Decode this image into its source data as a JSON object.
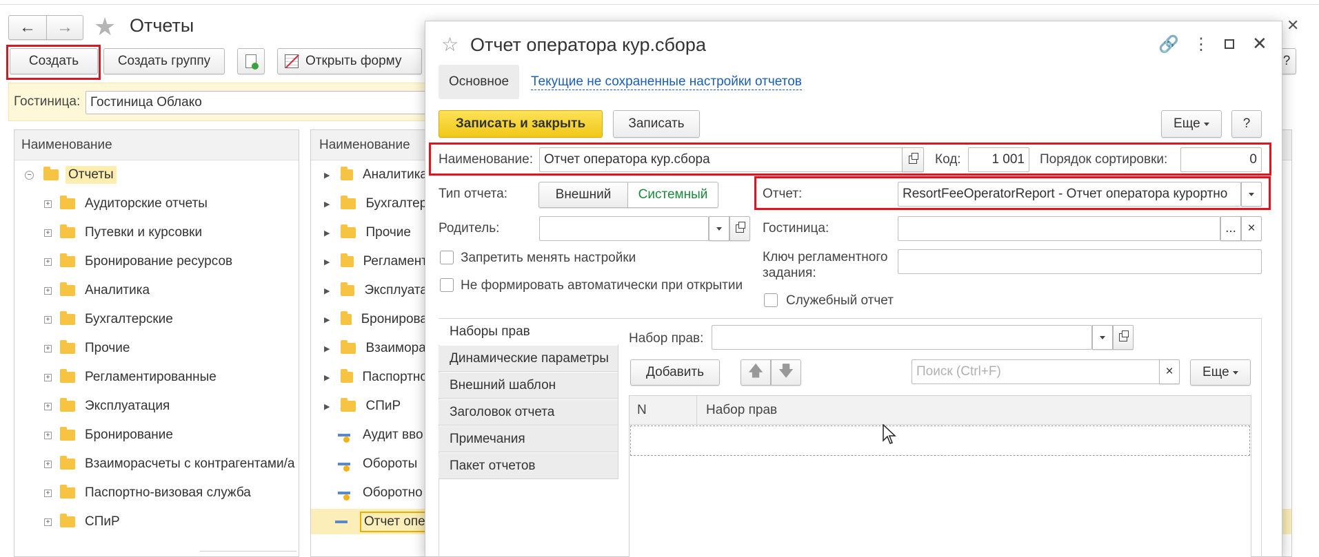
{
  "main": {
    "nav_back": "←",
    "nav_forward": "→",
    "title": "Отчеты",
    "toolbar": {
      "create": "Создать",
      "create_group": "Создать группу",
      "open_form": "Открыть форму"
    },
    "filter": {
      "label": "Гостиница:",
      "value": "Гостиница Облако"
    },
    "left_tree": {
      "header": "Наименование",
      "root": "Отчеты",
      "items": [
        "Аудиторские отчеты",
        "Путевки и курсовки",
        "Бронирование ресурсов",
        "Аналитика",
        "Бухгалтерские",
        "Прочие",
        "Регламентированные",
        "Эксплуатация",
        "Бронирование",
        "Взаиморасчеты с контрагентами/а",
        "Паспортно-визовая служба",
        "СПиР"
      ]
    },
    "right_list": {
      "header": "Наименование",
      "folders": [
        "Аналитика",
        "Бухгалтер",
        "Прочие",
        "Регламент",
        "Эксплуата",
        "Бронирова",
        "Взаимора",
        "Паспортно",
        "СПиР"
      ],
      "reports": [
        "Аудит вво",
        "Обороты",
        "Оборотно",
        "Отчет опе"
      ]
    },
    "help_char": "?"
  },
  "dialog": {
    "title": "Отчет оператора кур.сбора",
    "tabs": {
      "main": "Основное",
      "unsaved_link": "Текущие не сохраненные настройки отчетов"
    },
    "buttons": {
      "save_close": "Записать и закрыть",
      "save": "Записать",
      "more": "Еще",
      "help": "?"
    },
    "name_label": "Наименование:",
    "name_value": "Отчет оператора кур.сбора",
    "code_label": "Код:",
    "code_value": "1 001",
    "sort_label": "Порядок сортировки:",
    "sort_value": "0",
    "type_label": "Тип отчета:",
    "type_external": "Внешний",
    "type_system": "Системный",
    "report_label": "Отчет:",
    "report_value": "ResortFeeOperatorReport - Отчет оператора курортно",
    "parent_label": "Родитель:",
    "parent_value": "",
    "hotel_label": "Гостиница:",
    "hotel_value": "",
    "hotel_select": "...",
    "hotel_clear": "×",
    "forbid_settings": "Запретить менять настройки",
    "no_auto_form": "Не формировать автоматически при открытии",
    "job_key_label_1": "Ключ регламентного",
    "job_key_label_2": "задания:",
    "job_key_value": "",
    "service_report": "Служебный отчет",
    "side_tabs": [
      "Наборы прав",
      "Динамические параметры",
      "Внешний шаблон",
      "Заголовок отчета",
      "Примечания",
      "Пакет отчетов"
    ],
    "rights_label": "Набор прав:",
    "rights_value": "",
    "add_button": "Добавить",
    "up_arrow": "🡅",
    "down_arrow": "🡇",
    "search_placeholder": "Поиск (Ctrl+F)",
    "search_clear": "×",
    "more2": "Еще",
    "table": {
      "col_n": "N",
      "col_rights": "Набор прав"
    }
  },
  "colors": {
    "accent_yellow": "#f5d327",
    "red_highlight": "#e0141e",
    "link_blue": "#1c5fae",
    "system_green": "#1a8a3a"
  }
}
